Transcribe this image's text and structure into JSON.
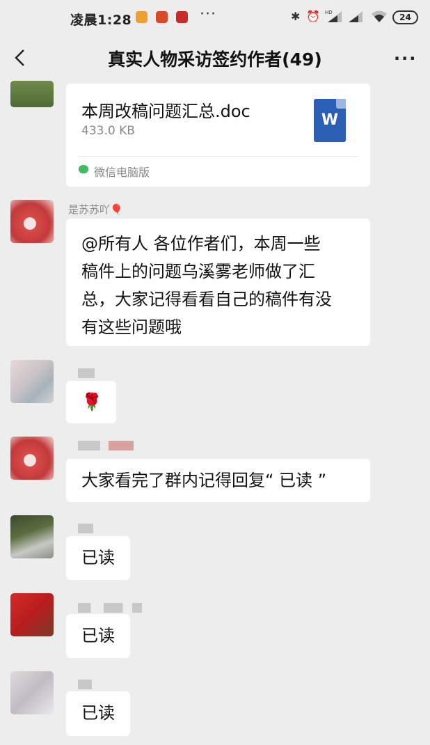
{
  "status_bar": {
    "time": "凌晨1:28",
    "dots": "···",
    "battery": "24",
    "signal_label": "HD"
  },
  "nav": {
    "title": "真实人物采访签约作者(49)",
    "more_label": "···"
  },
  "file_message": {
    "file_name": "本周改稿问题汇总.doc",
    "file_size": "433.0 KB",
    "source_label": "微信电脑版",
    "file_icon_letter": "W"
  },
  "messages": [
    {
      "sender": "是苏苏吖🎈",
      "text_lines": [
        "@所有人  各位作者们，本周一些",
        "稿件上的问题乌溪雾老师做了汇",
        "总，大家记得看看自己的稿件有没",
        "有这些问题哦"
      ]
    },
    {
      "sender": "",
      "text": "🌹"
    },
    {
      "sender": "",
      "text": "大家看完了群内记得回复“ 已读 ”"
    },
    {
      "sender": "",
      "text": "已读"
    },
    {
      "sender": "",
      "text": "已读"
    },
    {
      "sender": "",
      "text": "已读"
    }
  ],
  "colors": {
    "background": "#ededed",
    "bubble": "#ffffff",
    "word_blue": "#2b5fb6"
  }
}
